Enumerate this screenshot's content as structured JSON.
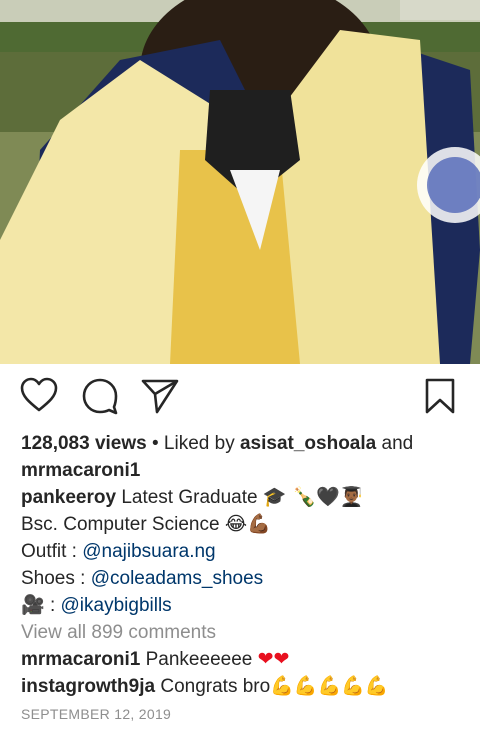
{
  "post": {
    "views": "128,083 views",
    "liked_by_prefix": "• Liked by",
    "liked_by_user1": "asisat_oshoala",
    "liked_by_and": "and",
    "liked_by_user2": "mrmacaroni1",
    "caption": {
      "username": "pankeeroy",
      "line1_text": "Latest Graduate",
      "line1_emoji": "🎓 🍾🖤👨🏾‍🎓",
      "line2_text": "Bsc. Computer Science",
      "line2_emoji": "😂💪🏾",
      "outfit_label": "Outfit :",
      "outfit_link": "@najibsuara.ng",
      "shoes_label": "Shoes :",
      "shoes_link": "@coleadams_shoes",
      "camera_emoji": "🎥",
      "camera_label": ":",
      "camera_link": "@ikaybigbills"
    },
    "view_all_comments": "View all 899 comments",
    "comments": [
      {
        "username": "mrmacaroni1",
        "text": "Pankeeeeee",
        "emoji": "❤❤"
      },
      {
        "username": "instagrowth9ja",
        "text": "Congrats bro",
        "emoji": "💪💪💪💪💪"
      }
    ],
    "date": "SEPTEMBER 12, 2019"
  },
  "icons": {
    "like": "heart-outline-icon",
    "comment": "comment-bubble-icon",
    "share": "paper-plane-icon",
    "save": "bookmark-icon"
  },
  "colors": {
    "link": "#00376b",
    "muted": "#8e8e8e",
    "text": "#262626",
    "heart": "#e8101f"
  }
}
